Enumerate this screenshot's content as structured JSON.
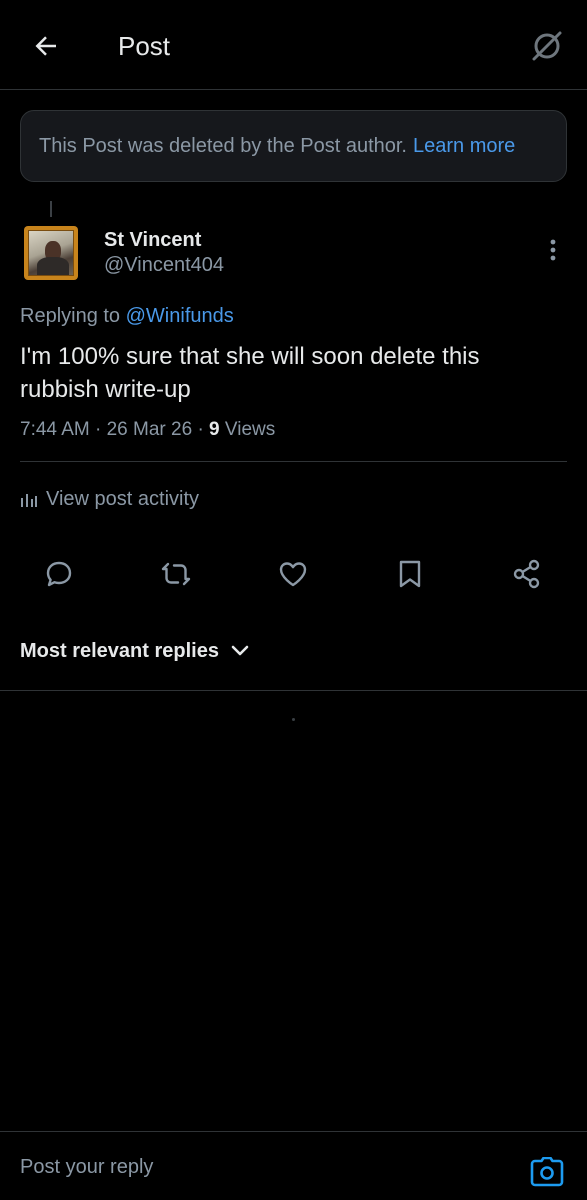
{
  "header": {
    "title": "Post",
    "back_icon": "arrow-left-icon",
    "grok_icon": "grok-icon"
  },
  "notice": {
    "text": "This Post was deleted by the Post author.",
    "link": "Learn more",
    "link_color": "#4a99e9"
  },
  "post": {
    "display_name": "St Vincent",
    "handle": "@Vincent404",
    "replying_prefix": "Replying to",
    "replying_to": "@Winifunds",
    "text": "I'm 100% sure that she will soon delete this rubbish write-up",
    "time": "7:44 AM",
    "date": "26 Mar 26",
    "views_count": "9",
    "views_label": "Views"
  },
  "activity": {
    "label": "View post activity",
    "icon": "bar-chart-icon"
  },
  "actions": [
    {
      "name": "reply",
      "icon": "reply-icon"
    },
    {
      "name": "repost",
      "icon": "repost-icon"
    },
    {
      "name": "like",
      "icon": "heart-icon"
    },
    {
      "name": "bookmark",
      "icon": "bookmark-icon"
    },
    {
      "name": "share",
      "icon": "share-icon"
    }
  ],
  "replies": {
    "sort_label": "Most relevant replies"
  },
  "composer": {
    "placeholder": "Post your reply",
    "camera_icon": "camera-icon"
  },
  "colors": {
    "background": "#000000",
    "accent": "#1d9bf0",
    "link": "#4a99e9",
    "muted_text": "#8b98a5",
    "primary_text": "#e7e9ea",
    "border": "#2f3336"
  }
}
